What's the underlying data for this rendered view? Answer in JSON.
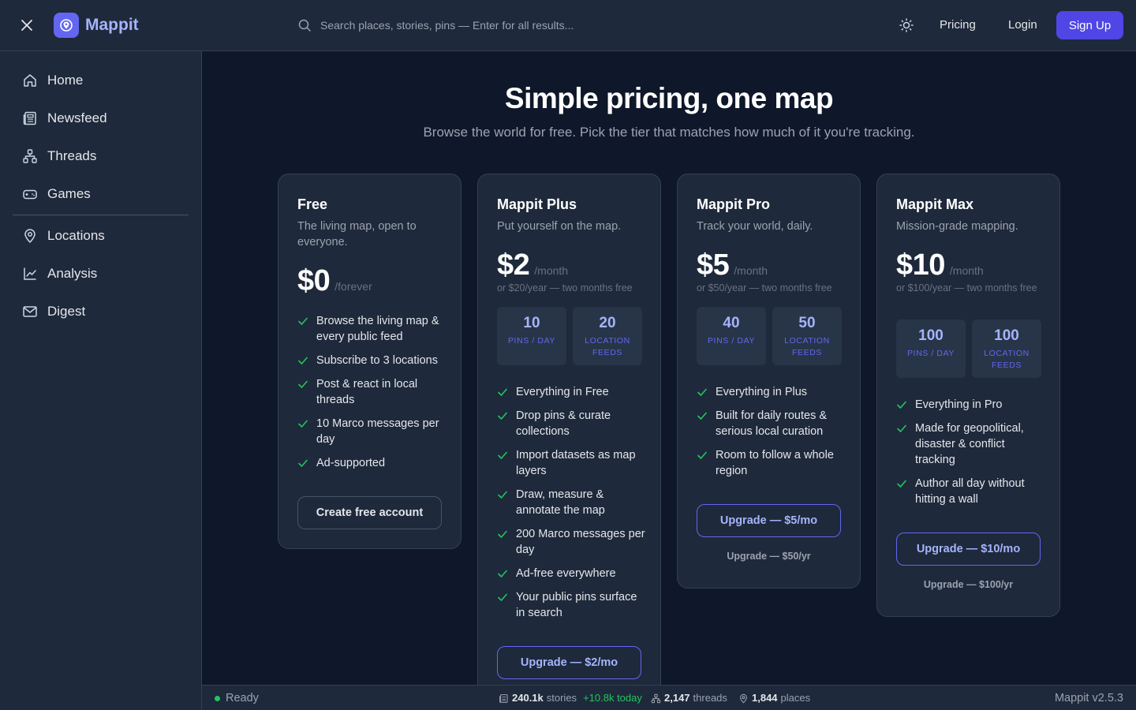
{
  "header": {
    "brand": "Mappit",
    "search_placeholder": "Search places, stories, pins — Enter for all results...",
    "pricing": "Pricing",
    "login": "Login",
    "signup": "Sign Up"
  },
  "sidebar": {
    "items": [
      {
        "label": "Home",
        "icon": "home-icon"
      },
      {
        "label": "Newsfeed",
        "icon": "newspaper-icon"
      },
      {
        "label": "Threads",
        "icon": "network-icon"
      },
      {
        "label": "Games",
        "icon": "gamepad-icon"
      },
      {
        "label": "Locations",
        "icon": "map-pin-icon"
      },
      {
        "label": "Analysis",
        "icon": "line-chart-icon"
      },
      {
        "label": "Digest",
        "icon": "mail-icon"
      }
    ]
  },
  "page": {
    "title": "Simple pricing, one map",
    "subtitle": "Browse the world for free. Pick the tier that matches how much of it you're tracking."
  },
  "plans": [
    {
      "name": "Free",
      "tagline": "The living map, open to everyone.",
      "price": "$0",
      "period": "/forever",
      "features": [
        "Browse the living map & every public feed",
        "Subscribe to 3 locations",
        "Post & react in local threads",
        "10 Marco messages per day",
        "Ad-supported"
      ],
      "cta": "Create free account"
    },
    {
      "name": "Mappit Plus",
      "tagline": "Put yourself on the map.",
      "price": "$2",
      "period": "/month",
      "annual": "or $20/year — two months free",
      "stats": [
        {
          "num": "10",
          "unit": "PINS / DAY"
        },
        {
          "num": "20",
          "unit": "LOCATION FEEDS"
        }
      ],
      "features": [
        "Everything in Free",
        "Drop pins & curate collections",
        "Import datasets as map layers",
        "Draw, measure & annotate the map",
        "200 Marco messages per day",
        "Ad-free everywhere",
        "Your public pins surface in search"
      ],
      "cta": "Upgrade — $2/mo"
    },
    {
      "name": "Mappit Pro",
      "tagline": "Track your world, daily.",
      "price": "$5",
      "period": "/month",
      "annual": "or $50/year — two months free",
      "stats": [
        {
          "num": "40",
          "unit": "PINS / DAY"
        },
        {
          "num": "50",
          "unit": "LOCATION FEEDS"
        }
      ],
      "features": [
        "Everything in Plus",
        "Built for daily routes & serious local curation",
        "Room to follow a whole region"
      ],
      "cta": "Upgrade — $5/mo",
      "yearly": "Upgrade — $50/yr"
    },
    {
      "name": "Mappit Max",
      "tagline": "Mission-grade mapping.",
      "price": "$10",
      "period": "/month",
      "annual": "or $100/year — two months free",
      "stats": [
        {
          "num": "100",
          "unit": "PINS / DAY"
        },
        {
          "num": "100",
          "unit": "LOCATION FEEDS"
        }
      ],
      "features": [
        "Everything in Pro",
        "Made for geopolitical, disaster & conflict tracking",
        "Author all day without hitting a wall"
      ],
      "cta": "Upgrade — $10/mo",
      "yearly": "Upgrade — $100/yr"
    }
  ],
  "status": {
    "ready": "Ready",
    "stories_count": "240.1k",
    "stories_label": "stories",
    "stories_today": "+10.8k today",
    "threads_count": "2,147",
    "threads_label": "threads",
    "places_count": "1,844",
    "places_label": "places",
    "version": "Mappit v2.5.3"
  },
  "colors": {
    "accent": "#4f46e5",
    "accent_light": "#a5b4fc",
    "check": "#22c55e",
    "background": "#0f172a",
    "panel": "#1e293b"
  }
}
